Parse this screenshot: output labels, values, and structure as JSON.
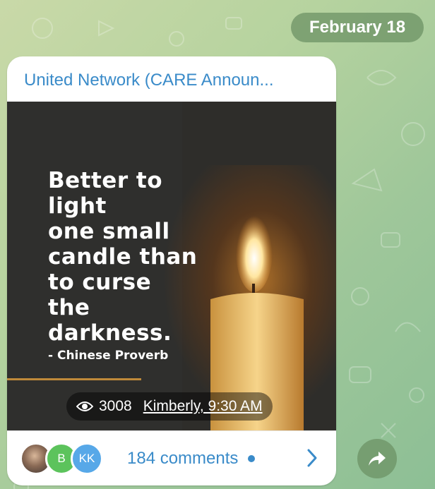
{
  "date_label": "February 18",
  "message": {
    "channel_name": "United Network (CARE Announ...",
    "image": {
      "quote_lines": [
        "Better to",
        "light",
        "one small",
        "candle than",
        "to curse",
        "the",
        "darkness."
      ],
      "attribution": "- Chinese Proverb"
    },
    "views": "3008",
    "sender_time": "Kimberly, 9:30 AM",
    "footer": {
      "avatars": [
        {
          "kind": "photo",
          "initials": ""
        },
        {
          "kind": "initials",
          "initials": "B",
          "color": "#5cc35c"
        },
        {
          "kind": "initials",
          "initials": "KK",
          "color": "#57a8e8"
        }
      ],
      "comments_label": "184 comments"
    }
  },
  "icons": {
    "views": "eye-icon",
    "open_comments": "chevron-right-icon",
    "share": "share-icon",
    "unread": "unread-dot-icon"
  },
  "colors": {
    "link_blue": "#3a8bc9",
    "wallpaper_green": "#9fc79a",
    "pill_green": "#6c9164"
  }
}
